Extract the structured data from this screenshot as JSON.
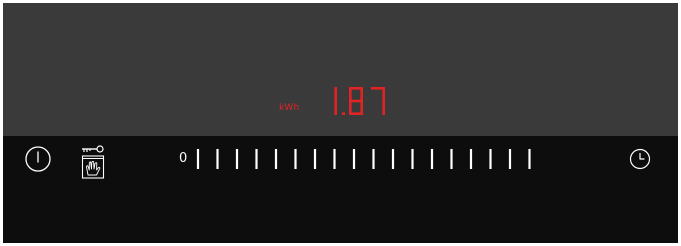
{
  "display": {
    "unit": "kWh",
    "value": "1.87",
    "color": "#e02424"
  },
  "controls": {
    "power_icon": "power-icon",
    "childlock_icon": "key-hand-childlock-icon",
    "timer_icon": "clock-icon"
  },
  "power_slider": {
    "min_label": "0",
    "level": 0,
    "steps": 18
  },
  "colors": {
    "display_bg": "#3a3a3a",
    "panel_bg": "#0d0d0d",
    "digit": "#e02424",
    "icon": "#ffffff"
  }
}
